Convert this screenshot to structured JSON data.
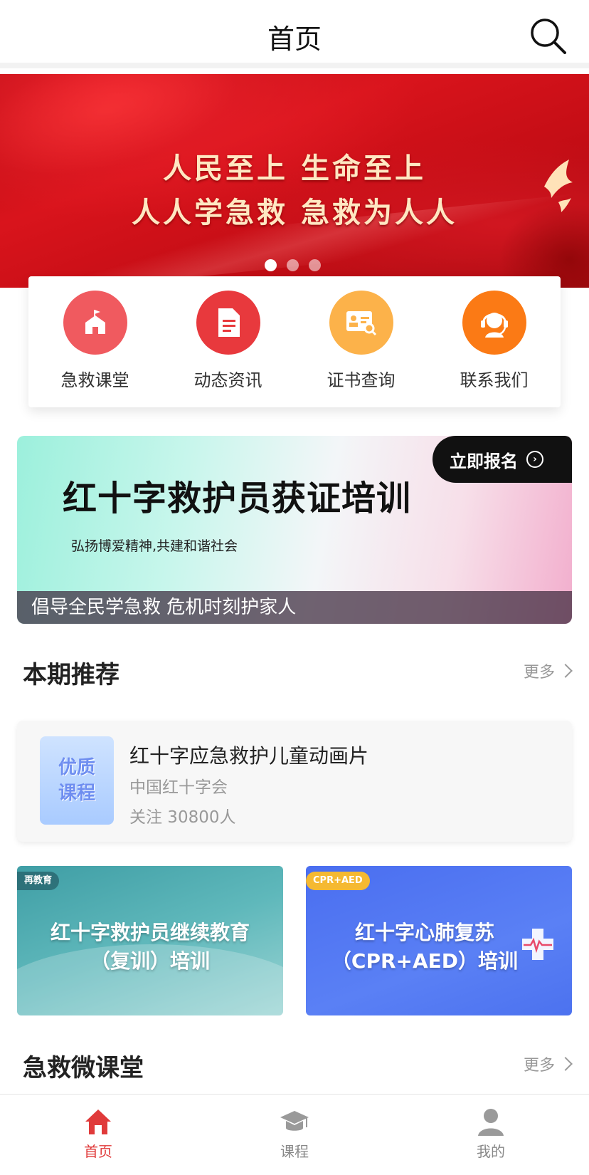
{
  "header": {
    "title": "首页",
    "search_icon": "search-icon"
  },
  "banner": {
    "line1": "人民至上  生命至上",
    "line2": "人人学急救  急救为人人",
    "dots": 3,
    "active_dot": 0
  },
  "quick_menu": [
    {
      "label": "急救课堂",
      "icon": "school-icon",
      "color": "#f05a5f"
    },
    {
      "label": "动态资讯",
      "icon": "document-icon",
      "color": "#e8393d"
    },
    {
      "label": "证书查询",
      "icon": "certificate-search-icon",
      "color": "#fcb24a"
    },
    {
      "label": "联系我们",
      "icon": "customer-service-icon",
      "color": "#fb7a15"
    }
  ],
  "promo": {
    "title": "红十字救护员获证培训",
    "subtitle": "弘扬博爱精神,共建和谐社会",
    "signup_label": "立即报名",
    "caption": "倡导全民学急救 危机时刻护家人"
  },
  "recommend": {
    "title": "本期推荐",
    "more_label": "更多",
    "course": {
      "thumb_line1": "优质",
      "thumb_line2": "课程",
      "title": "红十字应急救护儿童动画片",
      "org": "中国红十字会",
      "follow": "关注 30800人"
    },
    "tiles": [
      {
        "badge": "再教育",
        "line1": "红十字救护员继续教育",
        "line2": "（复训）培训"
      },
      {
        "badge": "CPR+AED",
        "line1": "红十字心肺复苏",
        "line2": "（CPR+AED）培训"
      }
    ]
  },
  "micro_class": {
    "title": "急救微课堂",
    "more_label": "更多"
  },
  "bottom_nav": [
    {
      "label": "首页",
      "icon": "home-icon",
      "active": true
    },
    {
      "label": "课程",
      "icon": "graduation-cap-icon",
      "active": false
    },
    {
      "label": "我的",
      "icon": "user-icon",
      "active": false
    }
  ],
  "colors": {
    "accent": "#e03a3a",
    "banner_red": "#c40d15",
    "nav_inactive": "#888888"
  }
}
